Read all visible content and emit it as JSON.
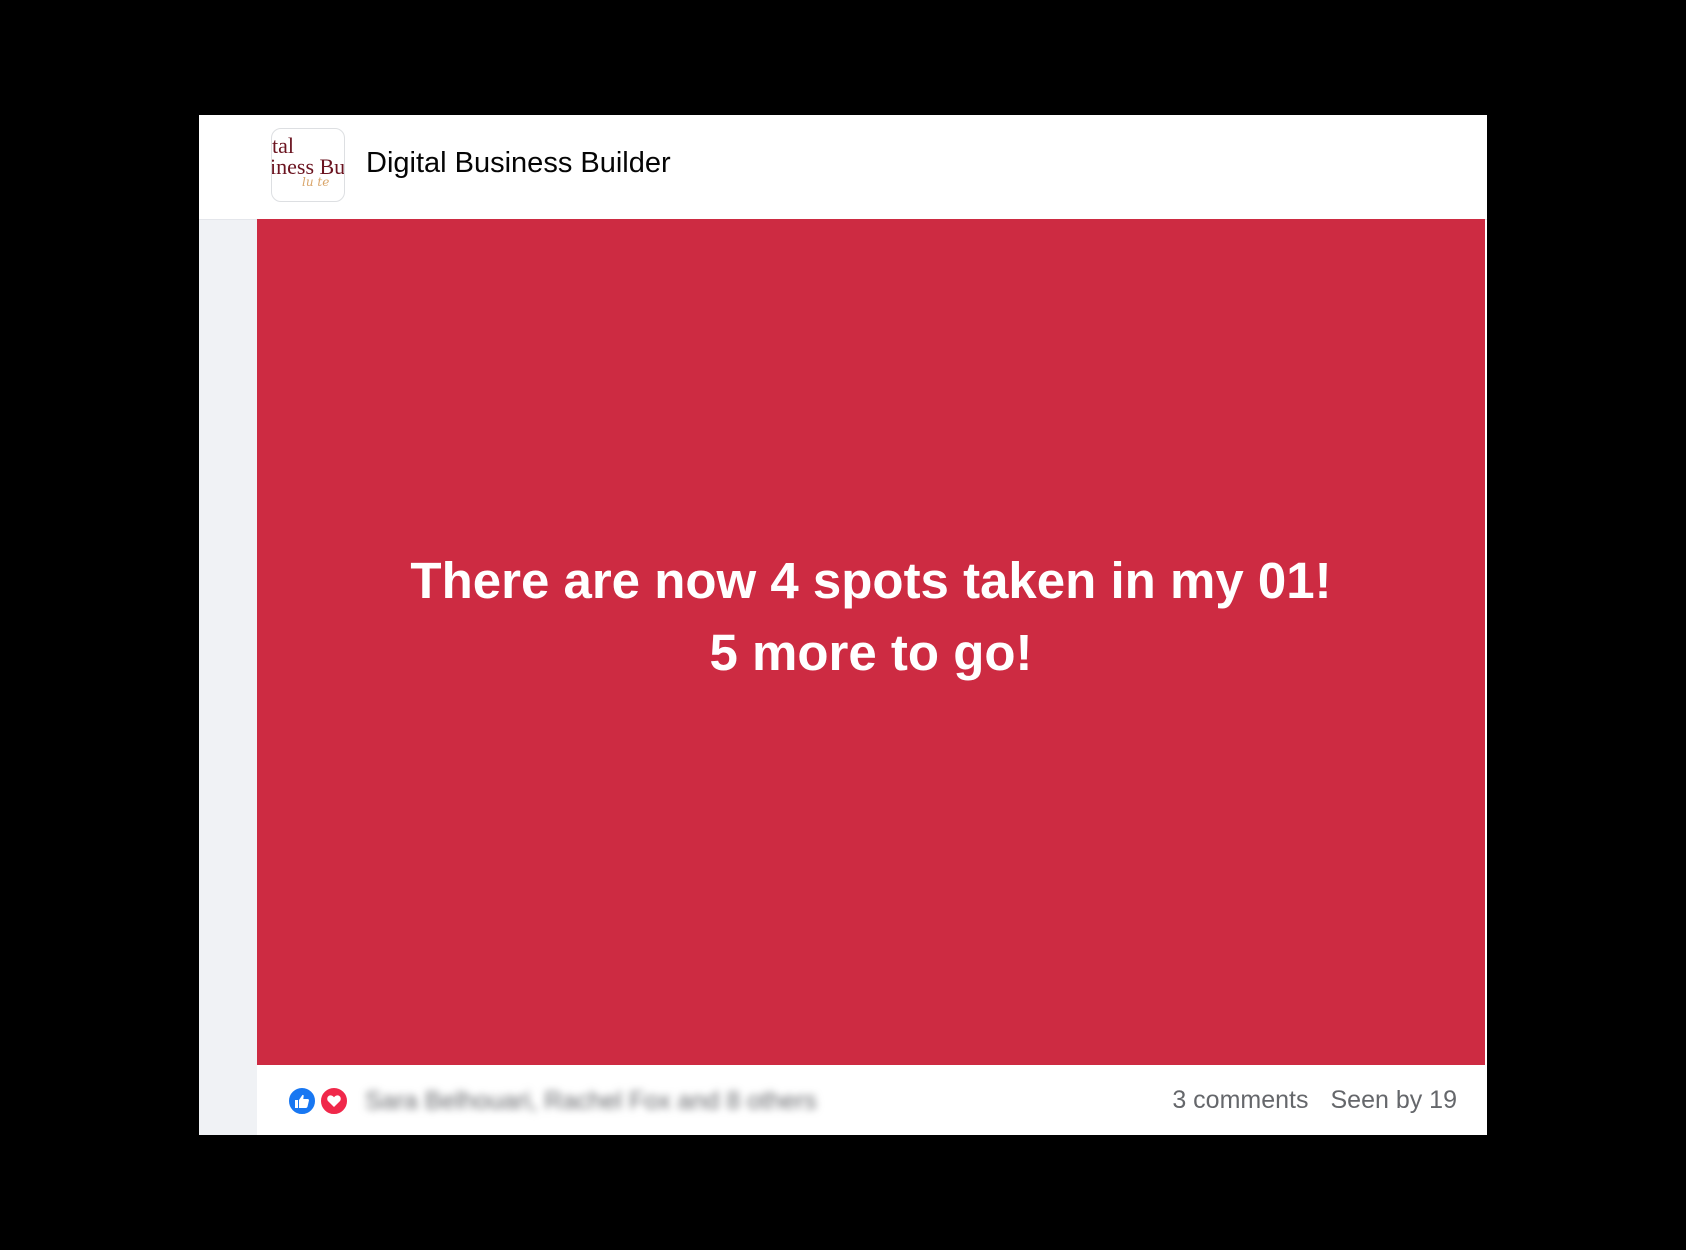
{
  "group": {
    "name": "Digital Business Builder",
    "logo_text": {
      "line1": "tal",
      "line2": "iness Bui",
      "script": "lu te"
    }
  },
  "post": {
    "line1": "There are now 4 spots taken in my 01!",
    "line2": "5 more to go!",
    "background_color": "#cd2b42"
  },
  "footer": {
    "reactions": [
      "like-icon",
      "love-icon"
    ],
    "reactors_text": "Sara Belhouari, Rachel Fox and 8 others",
    "comments": "3 comments",
    "seen_by": "Seen by 19"
  }
}
